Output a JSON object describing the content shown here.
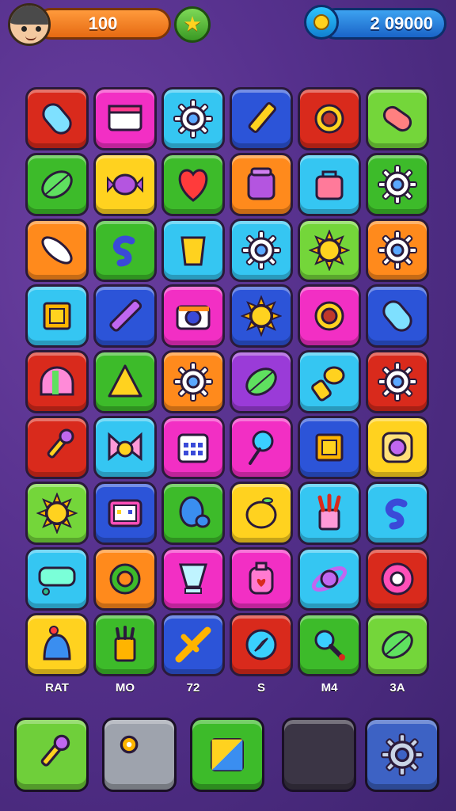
{
  "hud": {
    "coins": "100",
    "gems": "2 09000",
    "icons": [
      "avatar",
      "star-icon",
      "gem-icon"
    ]
  },
  "colors": {
    "red": "#d92a1c",
    "pink": "#f22fc4",
    "cyan": "#35c6f2",
    "blue": "#2c54d8",
    "green": "#3dbb2a",
    "lime": "#74d63a",
    "yellow": "#ffd21f",
    "orange": "#ff8a1c",
    "purple": "#9a3bd8"
  },
  "board": {
    "rows": [
      [
        {
          "bg": "red",
          "icon": "capsule-icon"
        },
        {
          "bg": "pink",
          "icon": "window-icon"
        },
        {
          "bg": "cyan",
          "icon": "gear-icon"
        },
        {
          "bg": "blue",
          "icon": "pencil-icon"
        },
        {
          "bg": "red",
          "icon": "ring-icon"
        },
        {
          "bg": "lime",
          "icon": "bandage-icon"
        }
      ],
      [
        {
          "bg": "green",
          "icon": "leaf-icon"
        },
        {
          "bg": "yellow",
          "icon": "candy-icon"
        },
        {
          "bg": "green",
          "icon": "heart-icon"
        },
        {
          "bg": "orange",
          "icon": "jar-icon"
        },
        {
          "bg": "cyan",
          "icon": "bag-icon"
        },
        {
          "bg": "green",
          "icon": "gear-icon"
        }
      ],
      [
        {
          "bg": "orange",
          "icon": "feather-icon"
        },
        {
          "bg": "green",
          "icon": "swirl-icon"
        },
        {
          "bg": "cyan",
          "icon": "cup-icon"
        },
        {
          "bg": "cyan",
          "icon": "gear-icon"
        },
        {
          "bg": "lime",
          "icon": "sun-icon"
        },
        {
          "bg": "orange",
          "icon": "gear-icon"
        }
      ],
      [
        {
          "bg": "cyan",
          "icon": "frame-icon"
        },
        {
          "bg": "blue",
          "icon": "crayon-icon"
        },
        {
          "bg": "pink",
          "icon": "camera-icon"
        },
        {
          "bg": "blue",
          "icon": "sun-icon"
        },
        {
          "bg": "pink",
          "icon": "ring-icon"
        },
        {
          "bg": "blue",
          "icon": "capsule-icon"
        }
      ],
      [
        {
          "bg": "red",
          "icon": "dome-icon"
        },
        {
          "bg": "green",
          "icon": "triangle-icon"
        },
        {
          "bg": "orange",
          "icon": "gear-icon"
        },
        {
          "bg": "purple",
          "icon": "leaf-icon"
        },
        {
          "bg": "cyan",
          "icon": "hand-icon"
        },
        {
          "bg": "red",
          "icon": "gear-icon"
        }
      ],
      [
        {
          "bg": "red",
          "icon": "brush-icon"
        },
        {
          "bg": "cyan",
          "icon": "bow-icon"
        },
        {
          "bg": "pink",
          "icon": "calendar-icon"
        },
        {
          "bg": "pink",
          "icon": "pin-icon"
        },
        {
          "bg": "blue",
          "icon": "frame-icon"
        },
        {
          "bg": "yellow",
          "icon": "flower-icon"
        }
      ],
      [
        {
          "bg": "lime",
          "icon": "sun-icon"
        },
        {
          "bg": "blue",
          "icon": "monitor-icon"
        },
        {
          "bg": "green",
          "icon": "mitt-icon"
        },
        {
          "bg": "yellow",
          "icon": "lemon-icon"
        },
        {
          "bg": "cyan",
          "icon": "brushes-icon"
        },
        {
          "bg": "cyan",
          "icon": "swirl-icon"
        }
      ],
      [
        {
          "bg": "cyan",
          "icon": "sign-icon"
        },
        {
          "bg": "orange",
          "icon": "target-icon"
        },
        {
          "bg": "pink",
          "icon": "glass-icon"
        },
        {
          "bg": "pink",
          "icon": "potion-icon"
        },
        {
          "bg": "cyan",
          "icon": "planet-icon"
        },
        {
          "bg": "red",
          "icon": "donut-icon"
        }
      ],
      [
        {
          "bg": "yellow",
          "icon": "bell-icon"
        },
        {
          "bg": "green",
          "icon": "pencils-icon"
        },
        {
          "bg": "blue",
          "icon": "wand-icon"
        },
        {
          "bg": "red",
          "icon": "compass-icon"
        },
        {
          "bg": "green",
          "icon": "magnifier-icon"
        },
        {
          "bg": "lime",
          "icon": "leaf-icon"
        }
      ]
    ]
  },
  "column_labels": [
    "RAT",
    "MO",
    "72",
    "S",
    "M4",
    "3A"
  ],
  "toolbar": [
    {
      "icon": "brush-icon",
      "bg": "#6fcf3a"
    },
    {
      "icon": "locked-icon",
      "bg": "#9ea3ad"
    },
    {
      "icon": "picture-icon",
      "bg": "#3dbb2a"
    },
    {
      "icon": "empty-slot",
      "bg": "#3b3545"
    },
    {
      "icon": "settings-icon",
      "bg": "#3d62c4"
    }
  ]
}
